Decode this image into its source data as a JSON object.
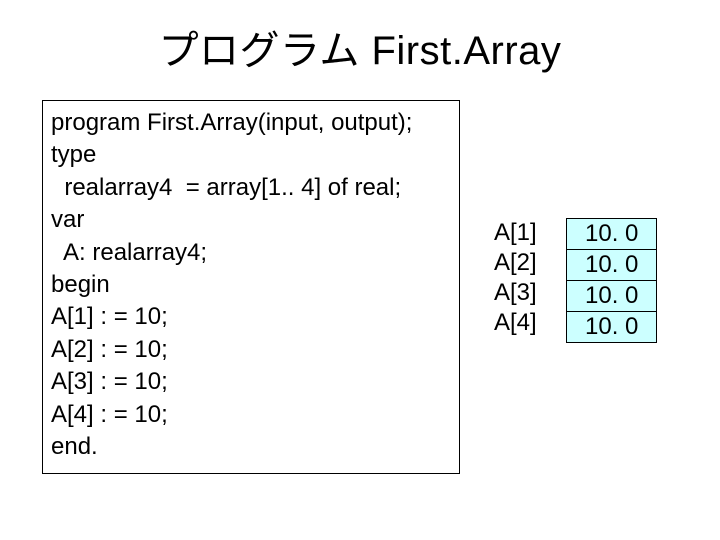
{
  "title": "プログラム First.Array",
  "code": {
    "l0": "program First.Array(input, output);",
    "l1": "type",
    "l2": "  realarray4  = array[1.. 4] of real;",
    "l3": "var",
    "l4": "  A: realarray4;",
    "l5": "begin",
    "l6": "A[1] : = 10;",
    "l7": "A[2] : = 10;",
    "l8": "A[3] : = 10;",
    "l9": "A[4] : = 10;",
    "l10": "end."
  },
  "array": {
    "labels": {
      "r0": "A[1]",
      "r1": "A[2]",
      "r2": "A[3]",
      "r3": "A[4]"
    },
    "values": {
      "r0": "10. 0",
      "r1": "10. 0",
      "r2": "10. 0",
      "r3": "10. 0"
    }
  }
}
